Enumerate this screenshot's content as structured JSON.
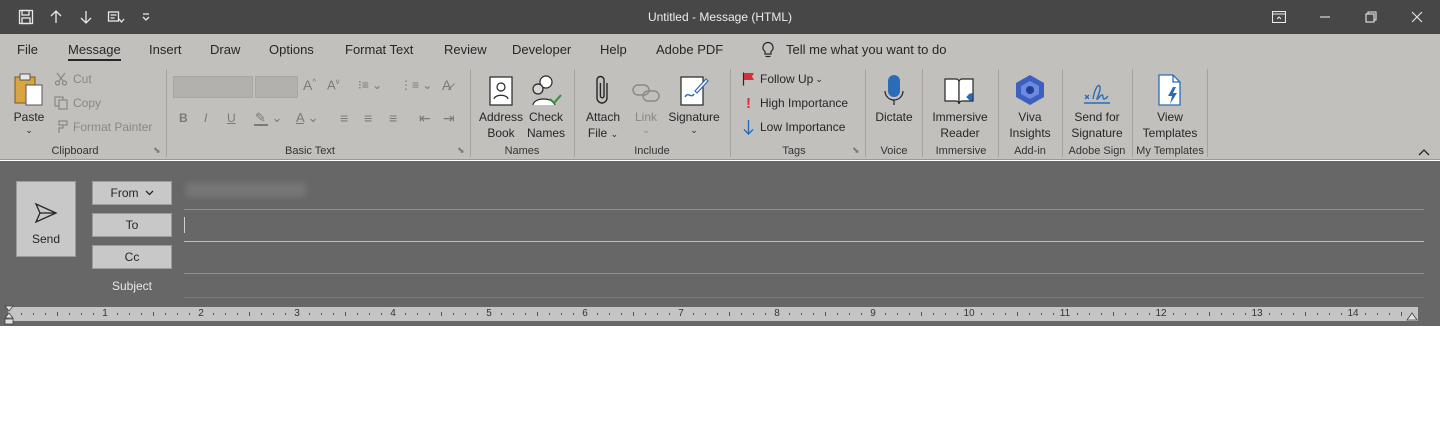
{
  "window": {
    "title": "Untitled  -  Message (HTML)"
  },
  "qat": {
    "save_icon": "save-icon",
    "up_icon": "arrow-up-icon",
    "down_icon": "arrow-down-icon",
    "customize_icon": "customize-icon",
    "more_icon": "chevron-down-icon"
  },
  "tabs": [
    {
      "label": "File"
    },
    {
      "label": "Message"
    },
    {
      "label": "Insert"
    },
    {
      "label": "Draw"
    },
    {
      "label": "Options"
    },
    {
      "label": "Format Text"
    },
    {
      "label": "Review"
    },
    {
      "label": "Developer"
    },
    {
      "label": "Help"
    },
    {
      "label": "Adobe PDF"
    }
  ],
  "tell_me": "Tell me what you want to do",
  "ribbon": {
    "clipboard": {
      "paste": "Paste",
      "cut": "Cut",
      "copy": "Copy",
      "format_painter": "Format Painter",
      "label": "Clipboard"
    },
    "basic_text": {
      "bold": "B",
      "italic": "I",
      "underline": "U",
      "label": "Basic Text"
    },
    "names": {
      "address_book_1": "Address",
      "address_book_2": "Book",
      "check_names_1": "Check",
      "check_names_2": "Names",
      "label": "Names"
    },
    "include": {
      "attach_1": "Attach",
      "attach_2": "File",
      "link": "Link",
      "signature": "Signature",
      "label": "Include"
    },
    "tags": {
      "follow_up": "Follow Up",
      "high_importance": "High Importance",
      "low_importance": "Low Importance",
      "label": "Tags",
      "flag_color": "#d13438",
      "high_color": "#d13438",
      "low_color": "#2b6cb8"
    },
    "voice": {
      "dictate": "Dictate",
      "label": "Voice"
    },
    "immersive": {
      "reader_1": "Immersive",
      "reader_2": "Reader",
      "label": "Immersive"
    },
    "addin": {
      "viva_1": "Viva",
      "viva_2": "Insights",
      "label": "Add-in"
    },
    "adobe_sign": {
      "send_1": "Send for",
      "send_2": "Signature",
      "label": "Adobe Sign"
    },
    "templates": {
      "view_1": "View",
      "view_2": "Templates",
      "label": "My Templates"
    }
  },
  "compose": {
    "send": "Send",
    "from": "From",
    "to": "To",
    "cc": "Cc",
    "subject": "Subject"
  },
  "ruler": {
    "numbers": [
      "1",
      "2",
      "3",
      "4",
      "5",
      "6",
      "7",
      "8",
      "9",
      "10",
      "11",
      "12",
      "13",
      "14"
    ]
  }
}
